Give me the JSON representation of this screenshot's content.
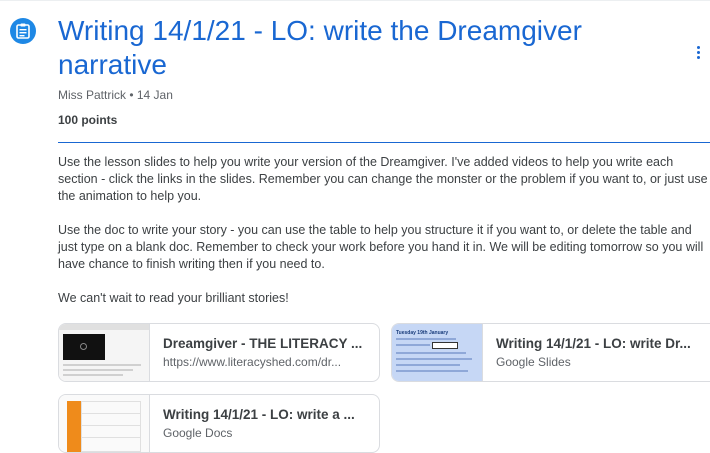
{
  "assignment": {
    "icon": "assignment-icon",
    "title": "Writing 14/1/21 - LO: write the Dreamgiver narrative",
    "author": "Miss Pattrick",
    "date": "14 Jan",
    "meta": "Miss Pattrick • 14 Jan",
    "points": "100 points",
    "instructions": [
      "Use the lesson slides to help you write your version of the Dreamgiver. I've added videos to help you write each section - click the links in the slides. Remember you can change the monster or the problem if you want to, or just use the animation to help you.",
      "Use the doc to write your story - you can use the table to help you structure it if you want to, or delete the table and just type on a blank doc. Remember to check your work before you hand it in. We will be editing tomorrow so you will have chance to finish writing then if you need to.",
      "We can't wait to read your brilliant stories!"
    ]
  },
  "attachments": [
    {
      "title": "Dreamgiver - THE LITERACY ...",
      "subtitle": "https://www.literacyshed.com/dr...",
      "thumb": "literacy-shed-page"
    },
    {
      "title": "Writing 14/1/21 - LO: write Dr...",
      "subtitle": "Google Slides",
      "thumb": "slides-preview",
      "thumb_text": [
        "Tuesday 19th January",
        "Click here for help"
      ]
    },
    {
      "title": "Writing 14/1/21 - LO: write a ...",
      "subtitle": "Google Docs",
      "thumb": "docs-preview"
    }
  ],
  "colors": {
    "accent": "#1967d2",
    "icon_bg": "#1e88e5",
    "text": "#3c4043",
    "muted": "#5f6368",
    "border": "#dadce0"
  }
}
